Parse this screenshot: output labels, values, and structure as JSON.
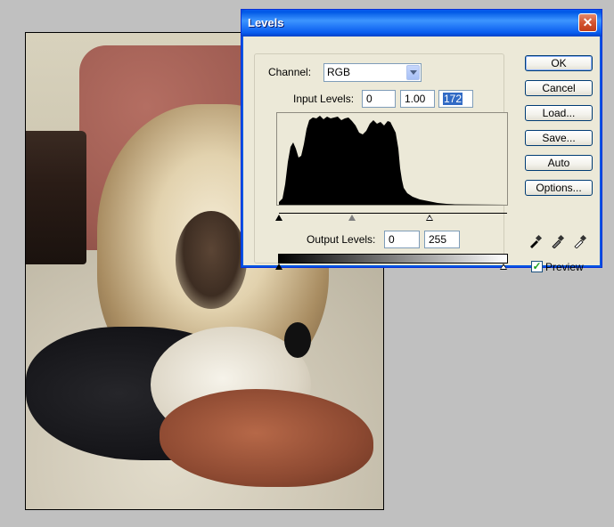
{
  "dialog": {
    "title": "Levels",
    "channel_label": "Channel:",
    "channel_value": "RGB",
    "input_levels_label": "Input Levels:",
    "input_black": "0",
    "input_gamma": "1.00",
    "input_white": "172",
    "output_levels_label": "Output Levels:",
    "output_black": "0",
    "output_white": "255",
    "buttons": {
      "ok": "OK",
      "cancel": "Cancel",
      "load": "Load...",
      "save": "Save...",
      "auto": "Auto",
      "options": "Options..."
    },
    "preview_label": "Preview",
    "preview_checked": true
  },
  "icons": {
    "close": "close-icon",
    "dropdown": "chevron-down-icon",
    "eyedropper_black": "black-eyedropper-icon",
    "eyedropper_gray": "gray-eyedropper-icon",
    "eyedropper_white": "white-eyedropper-icon"
  }
}
